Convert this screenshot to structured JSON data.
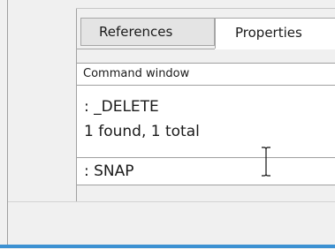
{
  "tabs": {
    "references_label": "References",
    "properties_label": "Properties"
  },
  "command_window": {
    "title": "Command window",
    "history": [
      ": _DELETE",
      "1 found, 1 total"
    ],
    "current_input": ": SNAP"
  },
  "icons": {
    "cursor": "text-cursor-icon"
  },
  "colors": {
    "accent": "#3c91d2",
    "tab_active_bg": "#ffffff",
    "tab_inactive_bg": "#e4e4e4"
  }
}
